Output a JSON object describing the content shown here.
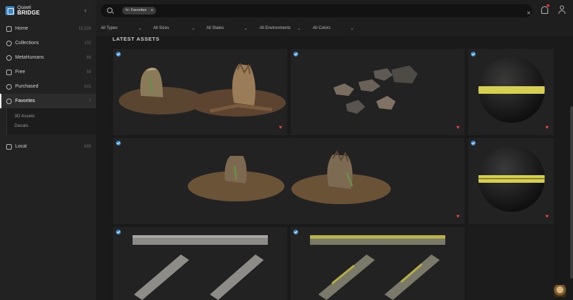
{
  "app": {
    "logo_line1": "Quixel",
    "logo_line2": "BRIDGE"
  },
  "sidebar": {
    "items": [
      {
        "label": "Home",
        "count": "15,028",
        "icon": "home-icon"
      },
      {
        "label": "Collections",
        "count": "102",
        "icon": "collections-icon"
      },
      {
        "label": "MetaHumans",
        "count": "66",
        "icon": "metahumans-icon"
      },
      {
        "label": "Free",
        "count": "55",
        "icon": "free-icon"
      },
      {
        "label": "Purchased",
        "count": "631",
        "icon": "purchased-icon"
      },
      {
        "label": "Favorites",
        "count": "7",
        "icon": "heart-icon"
      }
    ],
    "sub_items": [
      {
        "label": "3D Assets"
      },
      {
        "label": "Decals"
      }
    ],
    "local": {
      "label": "Local",
      "count": "695",
      "icon": "monitor-icon"
    }
  },
  "search": {
    "chip": "In: Favorites"
  },
  "filters": [
    {
      "label": "All Types"
    },
    {
      "label": "All Sizes"
    },
    {
      "label": "All States"
    },
    {
      "label": "All Environments"
    },
    {
      "label": "All Colors"
    }
  ],
  "main": {
    "section_title": "LATEST ASSETS"
  },
  "colors": {
    "accent": "#3a86c8",
    "favorite": "#e64545",
    "moss_yellow": "#d6cf52"
  }
}
